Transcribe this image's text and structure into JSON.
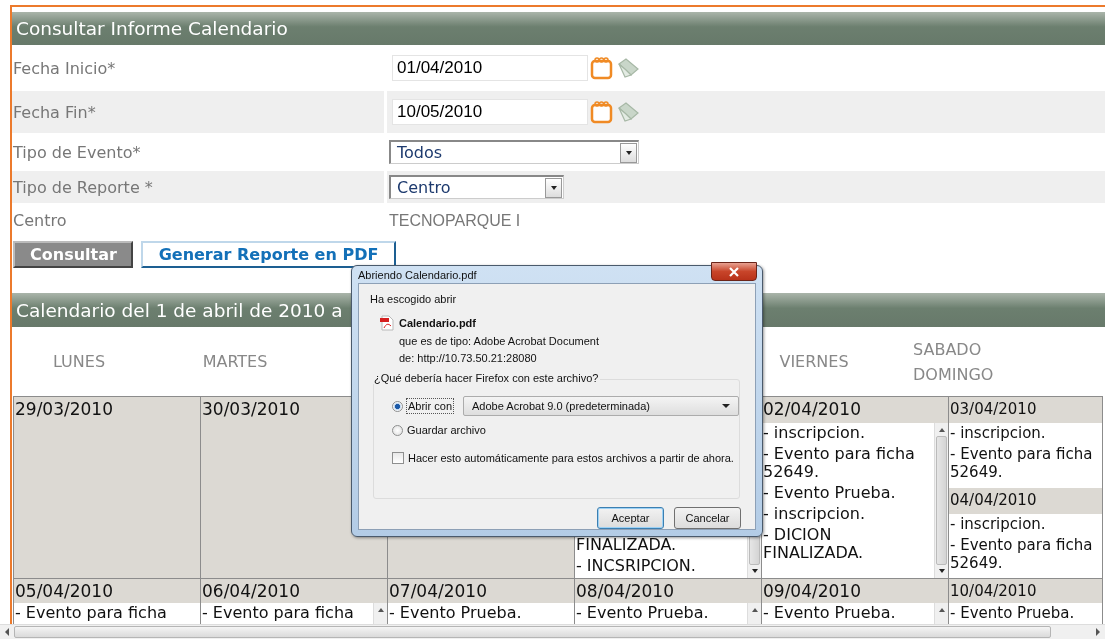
{
  "form": {
    "title": "Consultar Informe Calendario",
    "fields": [
      {
        "label": "Fecha Inicio*",
        "kind": "date",
        "value": "01/04/2010"
      },
      {
        "label": "Fecha Fin*",
        "kind": "date",
        "value": "10/05/2010"
      },
      {
        "label": "Tipo de Evento*",
        "kind": "select",
        "value": "Todos"
      },
      {
        "label": "Tipo de Reporte *",
        "kind": "select",
        "value": "Centro"
      },
      {
        "label": "Centro",
        "kind": "text",
        "value": "TECNOPARQUE I"
      }
    ],
    "buttons": [
      {
        "label": "Consultar",
        "kind": "primary"
      },
      {
        "label": "Generar Reporte en PDF",
        "kind": "secondary"
      }
    ]
  },
  "calendar": {
    "title": "Calendario del 1 de abril de 2010 a",
    "day_names": [
      "LUNES",
      "MARTES",
      "VIERNES",
      "SABADO DOMINGO"
    ],
    "weeks": [
      [
        {
          "days": [
            {
              "date": "29/03/2010"
            }
          ]
        },
        {
          "days": [
            {
              "date": "30/03/2010"
            }
          ]
        },
        {
          "kind": "blank"
        },
        {
          "scrollbar": true,
          "days": [
            {
              "events": [
                "FINALIZADA.",
                "- INCSRIPCION."
              ]
            }
          ]
        },
        {
          "scrollbar": true,
          "days": [
            {
              "date": "02/04/2010",
              "events": [
                "- inscripcion.",
                "- Evento para ficha 52649.",
                "- Evento Prueba.",
                "- inscripcion.",
                "- DICION FINALIZADA."
              ]
            }
          ]
        },
        {
          "days": [
            {
              "date": "03/04/2010",
              "events": [
                "- inscripcion.",
                "- Evento para ficha 52649."
              ]
            },
            {
              "date": "04/04/2010",
              "events": [
                "- inscripcion.",
                "- Evento para ficha 52649."
              ]
            }
          ]
        }
      ],
      [
        {
          "days": [
            {
              "date": "05/04/2010",
              "events": [
                "- Evento para ficha"
              ]
            }
          ]
        },
        {
          "scrollbar": true,
          "days": [
            {
              "date": "06/04/2010",
              "events": [
                "- Evento para ficha"
              ]
            }
          ]
        },
        {
          "days": [
            {
              "date": "07/04/2010",
              "events": [
                "- Evento Prueba."
              ]
            }
          ]
        },
        {
          "scrollbar": true,
          "days": [
            {
              "date": "08/04/2010",
              "events": [
                "- Evento Prueba."
              ]
            }
          ]
        },
        {
          "scrollbar": true,
          "days": [
            {
              "date": "09/04/2010",
              "events": [
                "- Evento Prueba."
              ]
            }
          ]
        },
        {
          "days": [
            {
              "date": "10/04/2010",
              "events": [
                "- Evento Prueba."
              ]
            }
          ]
        }
      ]
    ]
  },
  "dialog": {
    "title": "Abriendo Calendario.pdf",
    "intro": "Ha escogido abrir",
    "file_name": "Calendario.pdf",
    "file_type": "que es de tipo: Adobe Acrobat Document",
    "source": "de: http://10.73.50.21:28080",
    "question": "¿Qué debería hacer Firefox con este archivo?",
    "options": [
      {
        "label": "Abrir con",
        "selected": true,
        "app": "Adobe Acrobat 9.0 (predeterminada)"
      },
      {
        "label": "Guardar archivo",
        "selected": false
      }
    ],
    "remember": {
      "label": "Hacer esto automáticamente para estos archivos a partir de ahora.",
      "checked": false
    },
    "buttons": [
      {
        "label": "Aceptar",
        "kind": "default"
      },
      {
        "label": "Cancelar",
        "kind": "normal"
      }
    ]
  }
}
